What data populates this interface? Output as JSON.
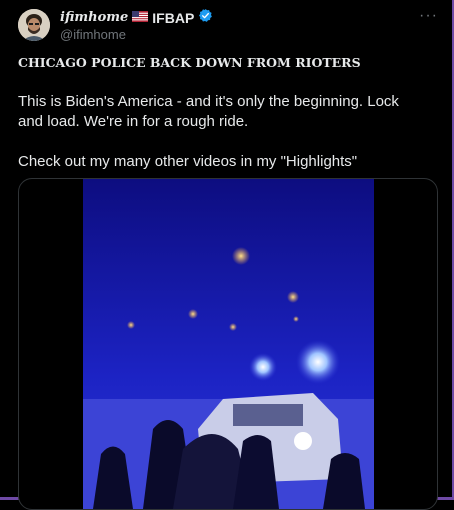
{
  "post": {
    "author": {
      "name_script": "ifimhome",
      "flag_icon": "us-flag-icon",
      "name_tag": "IFBAP",
      "verified_icon": "verified-badge-icon",
      "verified_color": "#1d9bf0",
      "handle": "@ifimhome"
    },
    "more_label": "···",
    "title": "CHICAGO POLICE BACK DOWN FROM RIOTERS",
    "body": "This is Biden's America - and it's only the beginning. Lock and load. We're in for a rough ride.\n\nCheck out my many other videos in my \"Highlights\"",
    "media": {
      "kind": "video"
    }
  },
  "colors": {
    "background": "#000000",
    "text": "#e7e9ea",
    "secondary_text": "#71767b",
    "accent_frame": "#6f4aa6"
  }
}
